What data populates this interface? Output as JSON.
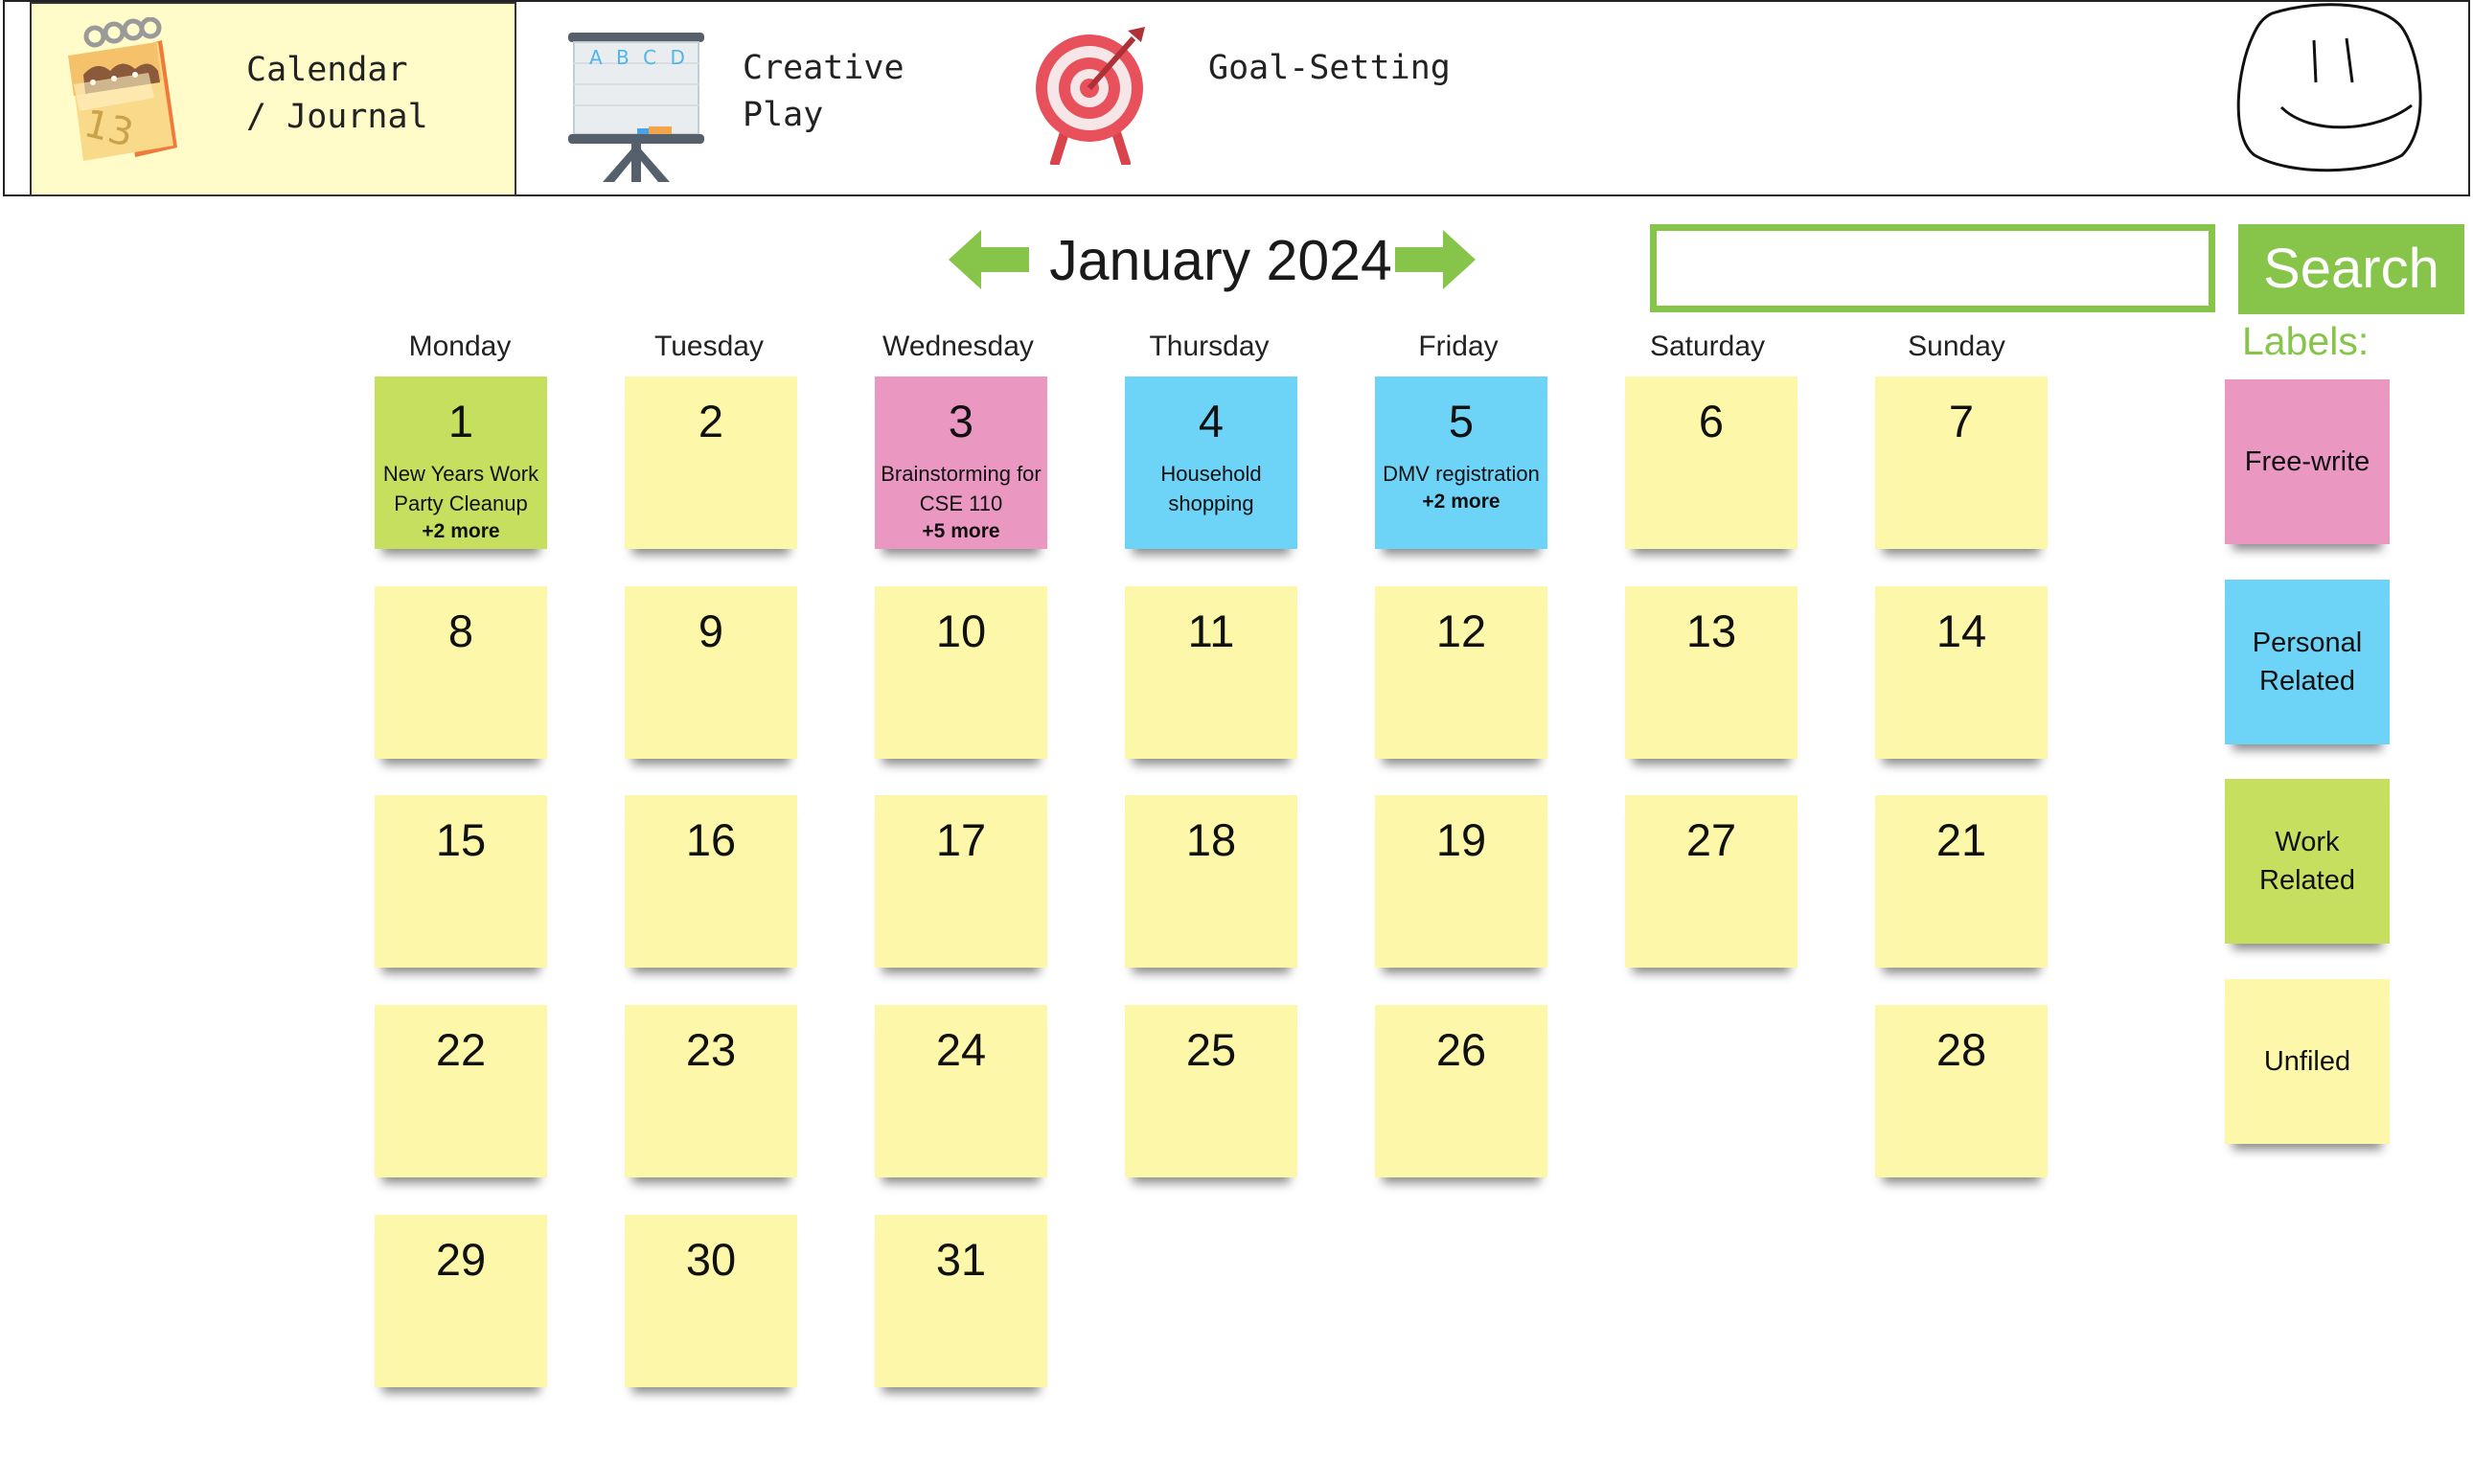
{
  "nav": {
    "items": [
      {
        "label": "Calendar\n/ Journal",
        "icon": "calendar-icon",
        "active": true
      },
      {
        "label": "Creative\nPlay",
        "icon": "easel-board-icon",
        "active": false
      },
      {
        "label": "Goal-Setting",
        "icon": "target-icon",
        "active": false
      }
    ],
    "avatar": "smiley-doodle-icon",
    "easel_letters": "A B C D"
  },
  "calendar": {
    "month_title": "January 2024",
    "prev": "left-arrow-icon",
    "next": "right-arrow-icon",
    "weekdays": [
      "Monday",
      "Tuesday",
      "Wednesday",
      "Thursday",
      "Friday",
      "Saturday",
      "Sunday"
    ],
    "days": [
      {
        "num": "1",
        "events": "New Years Work Party Cleanup",
        "more": "+2 more",
        "color": "#c6df5e"
      },
      {
        "num": "2",
        "color": "#fcf7a9"
      },
      {
        "num": "3",
        "events": "Brainstorming for CSE 110",
        "more": "+5 more",
        "color": "#ea97c1"
      },
      {
        "num": "4",
        "events": "Household shopping",
        "color": "#6ed4f7"
      },
      {
        "num": "5",
        "events": "DMV registration",
        "more": "+2 more",
        "color": "#6ed4f7"
      },
      {
        "num": "6",
        "color": "#fcf7a9"
      },
      {
        "num": "7",
        "color": "#fcf7a9"
      },
      {
        "num": "8",
        "color": "#fcf7a9"
      },
      {
        "num": "9",
        "color": "#fcf7a9"
      },
      {
        "num": "10",
        "color": "#fcf7a9"
      },
      {
        "num": "11",
        "color": "#fcf7a9"
      },
      {
        "num": "12",
        "color": "#fcf7a9"
      },
      {
        "num": "13",
        "color": "#fcf7a9"
      },
      {
        "num": "14",
        "color": "#fcf7a9"
      },
      {
        "num": "15",
        "color": "#fcf7a9"
      },
      {
        "num": "16",
        "color": "#fcf7a9"
      },
      {
        "num": "17",
        "color": "#fcf7a9"
      },
      {
        "num": "18",
        "color": "#fcf7a9"
      },
      {
        "num": "19",
        "color": "#fcf7a9"
      },
      {
        "num": "27",
        "color": "#fcf7a9"
      },
      {
        "num": "21",
        "color": "#fcf7a9"
      },
      {
        "num": "22",
        "color": "#fcf7a9"
      },
      {
        "num": "23",
        "color": "#fcf7a9"
      },
      {
        "num": "24",
        "color": "#fcf7a9"
      },
      {
        "num": "25",
        "color": "#fcf7a9"
      },
      {
        "num": "26",
        "color": "#fcf7a9"
      },
      {
        "num": "28",
        "color": "#fcf7a9"
      },
      {
        "num": "29",
        "color": "#fcf7a9"
      },
      {
        "num": "30",
        "color": "#fcf7a9"
      },
      {
        "num": "31",
        "color": "#fcf7a9"
      }
    ]
  },
  "search": {
    "placeholder": "",
    "button_label": "Search"
  },
  "labels": {
    "heading": "Labels:",
    "items": [
      {
        "name": "Free-write",
        "color": "#ea97c1"
      },
      {
        "name": "Personal\nRelated",
        "color": "#6ed4f7"
      },
      {
        "name": "Work\nRelated",
        "color": "#c6df5e"
      },
      {
        "name": "Unfiled",
        "color": "#fcf7a9"
      }
    ]
  },
  "colors": {
    "accent": "#86c44a",
    "active_nav_bg": "#fffcc9"
  }
}
